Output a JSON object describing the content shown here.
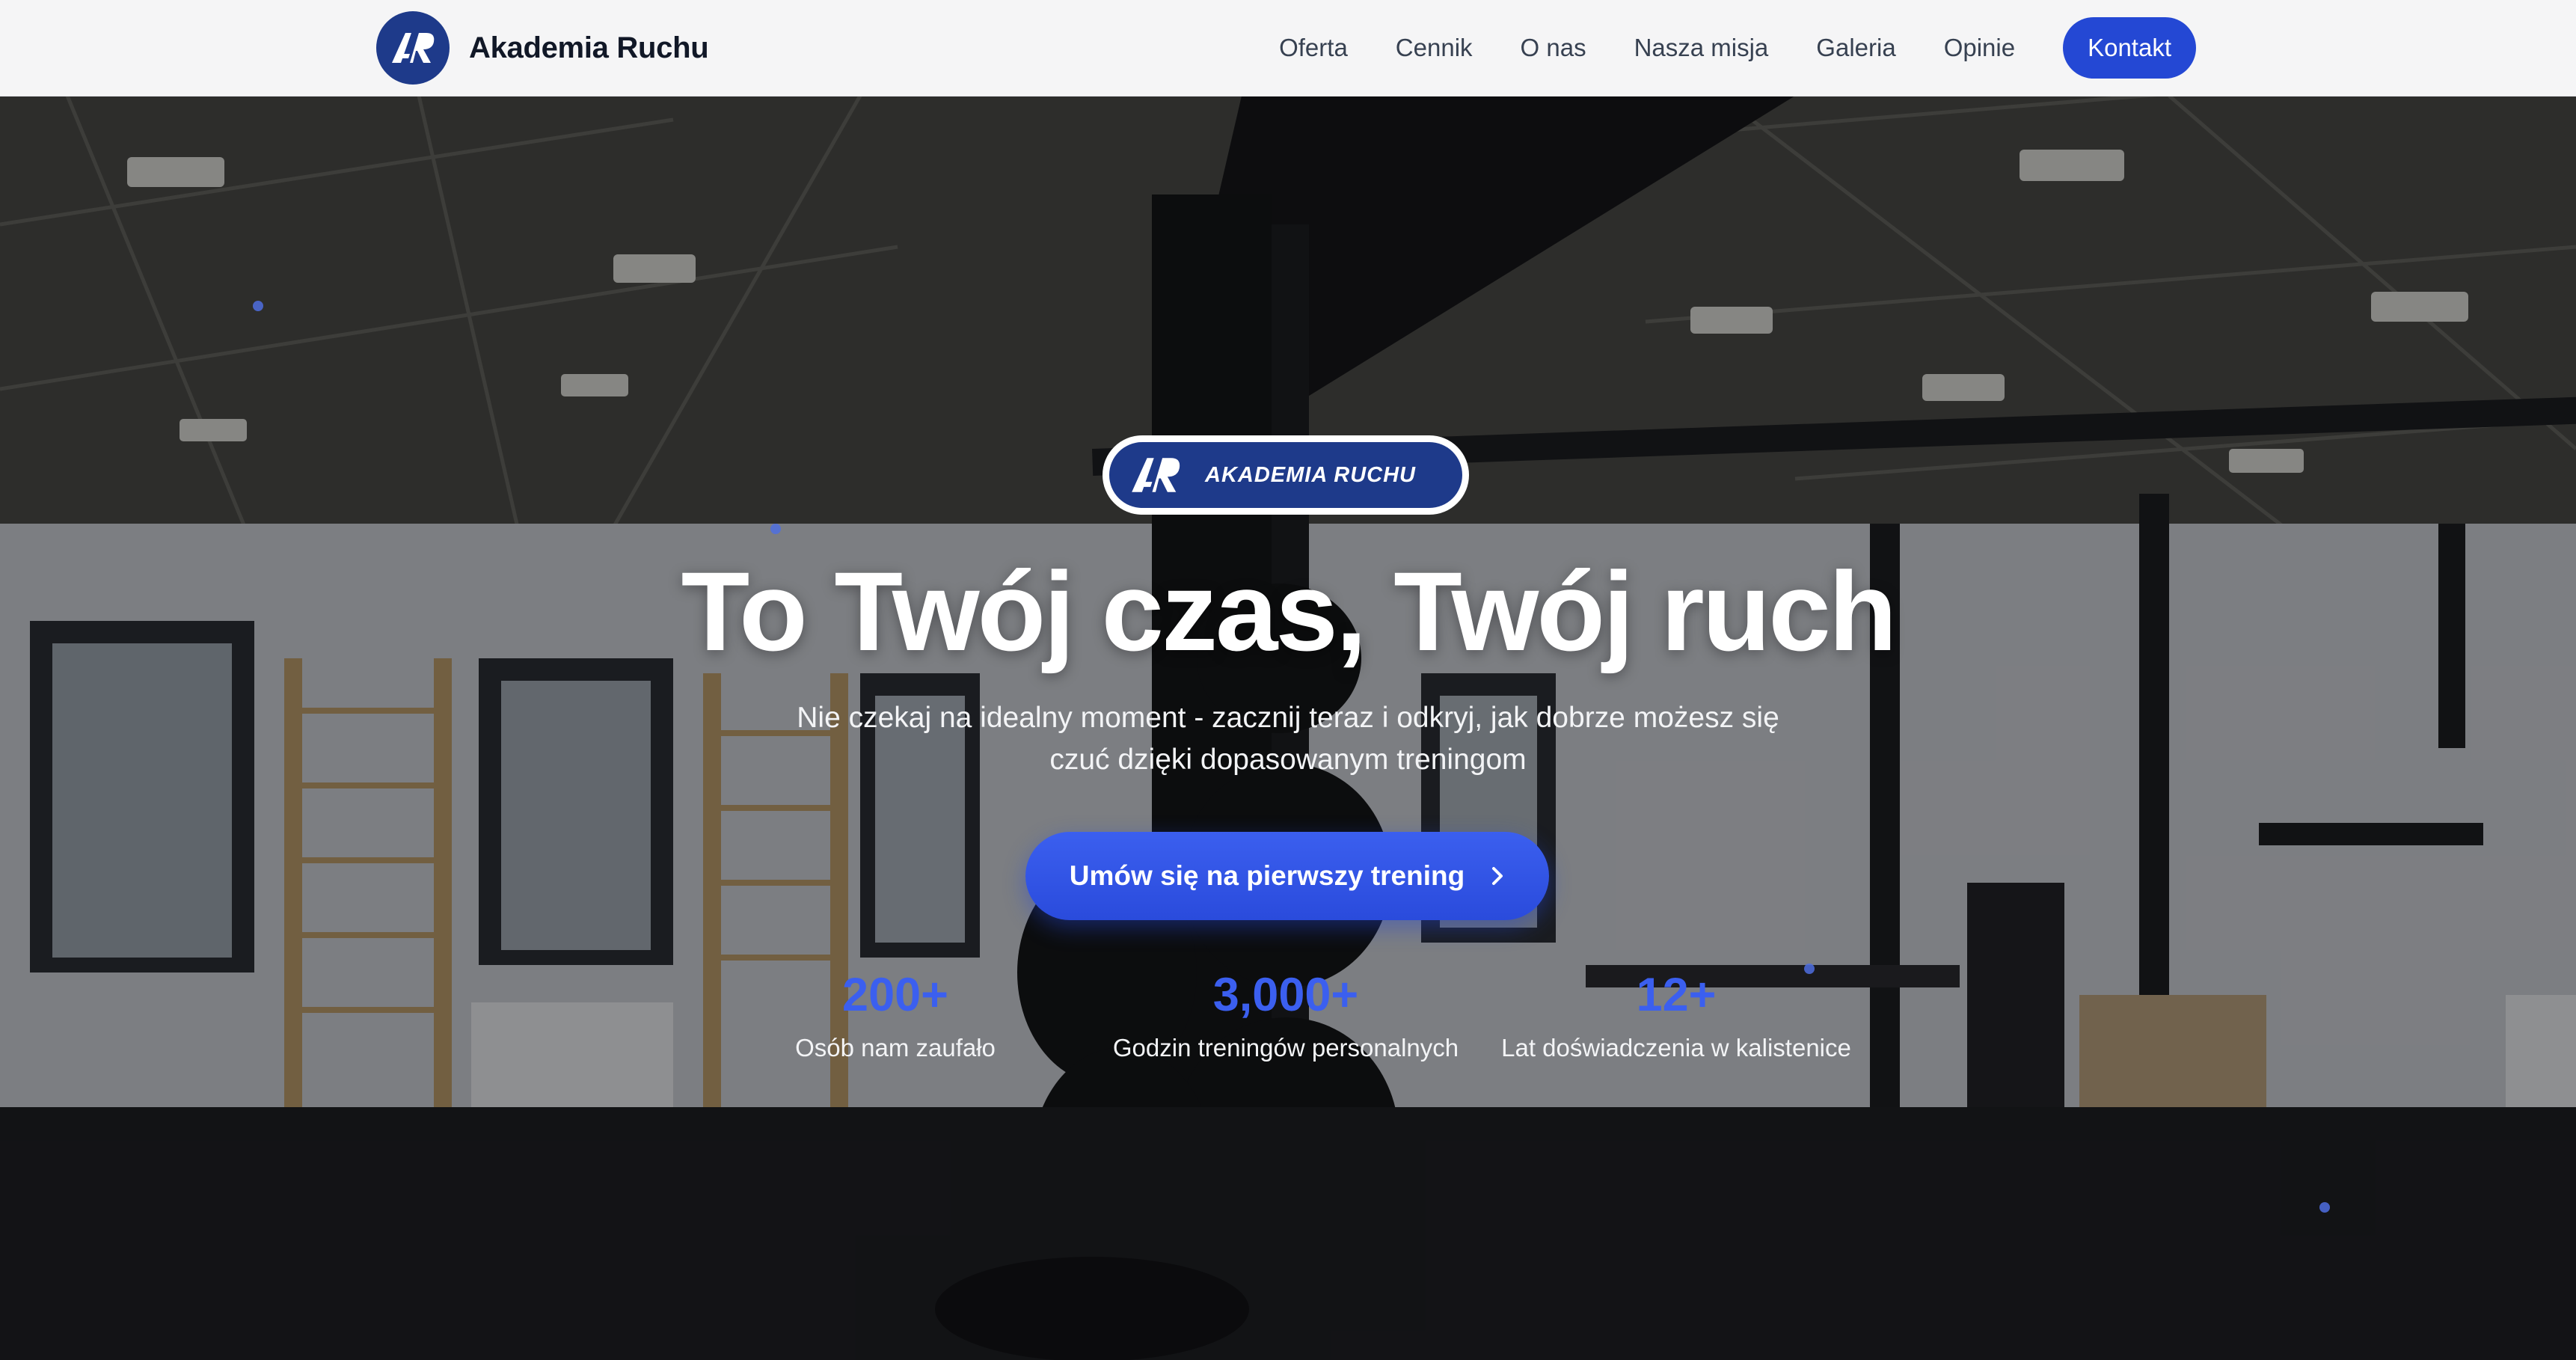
{
  "header": {
    "brand_name": "Akademia Ruchu",
    "nav": [
      "Oferta",
      "Cennik",
      "O nas",
      "Nasza misja",
      "Galeria",
      "Opinie"
    ],
    "cta_label": "Kontakt"
  },
  "hero": {
    "badge_text": "AKADEMIA RUCHU",
    "headline": "To Twój czas, Twój ruch",
    "subtitle": "Nie czekaj na idealny moment - zacznij teraz i odkryj, jak dobrze możesz się czuć dzięki dopasowanym treningom",
    "cta_label": "Umów się na pierwszy trening",
    "stats": [
      {
        "value": "200+",
        "label": "Osób nam zaufało"
      },
      {
        "value": "3,000+",
        "label": "Godzin treningów personalnych"
      },
      {
        "value": "12+",
        "label": "Lat doświadczenia w kalistenice"
      }
    ]
  },
  "colors": {
    "accent": "#2448d4",
    "brand_navy": "#1e3a8a",
    "stat_blue": "#3b5fef"
  },
  "icons": {
    "logo": "ar-logo-icon",
    "cta_arrow": "chevron-right-icon"
  }
}
